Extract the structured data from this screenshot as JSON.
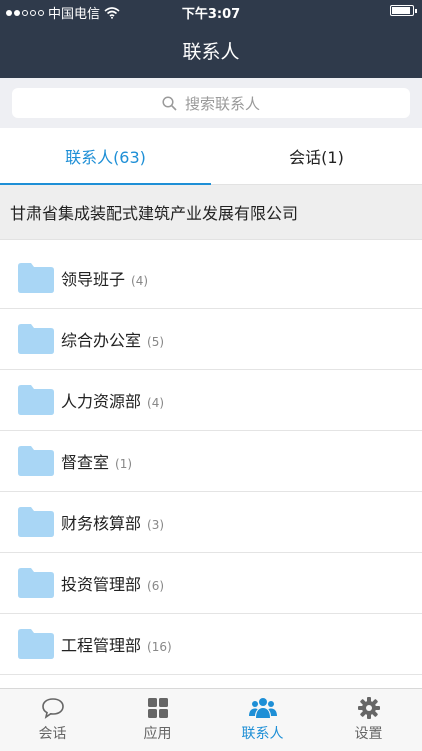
{
  "status": {
    "carrier": "中国电信",
    "time": "下午3:07",
    "signal": [
      true,
      true,
      false,
      false,
      false
    ],
    "battery_level": 0.9
  },
  "header": {
    "title": "联系人"
  },
  "search": {
    "placeholder": "搜索联系人"
  },
  "tabs": [
    {
      "label": "联系人(63)",
      "active": true
    },
    {
      "label": "会话(1)",
      "active": false
    }
  ],
  "organization": {
    "name": "甘肃省集成装配式建筑产业发展有限公司"
  },
  "departments": [
    {
      "name": "领导班子",
      "count": "(4)"
    },
    {
      "name": "综合办公室",
      "count": "(5)"
    },
    {
      "name": "人力资源部",
      "count": "(4)"
    },
    {
      "name": "督查室",
      "count": "(1)"
    },
    {
      "name": "财务核算部",
      "count": "(3)"
    },
    {
      "name": "投资管理部",
      "count": "(6)"
    },
    {
      "name": "工程管理部",
      "count": "(16)"
    }
  ],
  "tabbar": [
    {
      "label": "会话",
      "icon": "chat-bubble-icon",
      "active": false
    },
    {
      "label": "应用",
      "icon": "apps-grid-icon",
      "active": false
    },
    {
      "label": "联系人",
      "icon": "contacts-group-icon",
      "active": true
    },
    {
      "label": "设置",
      "icon": "gear-icon",
      "active": false
    }
  ],
  "colors": {
    "header_bg": "#2f3a4b",
    "accent": "#1e8fd6",
    "folder": "#a9d6f5"
  }
}
